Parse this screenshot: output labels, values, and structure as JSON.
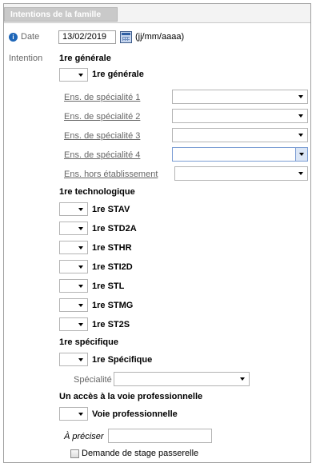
{
  "header": {
    "title": "Intentions de la famille"
  },
  "date": {
    "label": "Date",
    "value": "13/02/2019",
    "format_hint": "(jj/mm/aaaa)"
  },
  "intention_label": "Intention",
  "sections": {
    "generale": {
      "title": "1re générale",
      "option": "1re générale",
      "fields": [
        {
          "label": "Ens. de spécialité 1",
          "value": ""
        },
        {
          "label": "Ens. de spécialité 2",
          "value": ""
        },
        {
          "label": "Ens. de spécialité 3",
          "value": ""
        },
        {
          "label": "Ens. de spécialité 4",
          "value": ""
        },
        {
          "label": "Ens. hors établissement",
          "value": ""
        }
      ]
    },
    "technologique": {
      "title": "1re technologique",
      "options": [
        "1re STAV",
        "1re STD2A",
        "1re STHR",
        "1re STI2D",
        "1re STL",
        "1re STMG",
        "1re ST2S"
      ]
    },
    "specifique": {
      "title": "1re spécifique",
      "option": "1re Spécifique",
      "specialite_label": "Spécialité",
      "specialite_value": ""
    },
    "pro": {
      "title": "Un accès à la voie professionnelle",
      "option": "Voie professionnelle",
      "preciser_label": "À préciser",
      "preciser_value": "",
      "passerelle_label": "Demande de stage passerelle",
      "passerelle_checked": false
    }
  },
  "colors": {
    "info_icon": "#1e66b8",
    "header_tab": "#c9c9c9",
    "focus_border": "#7a9cd3"
  }
}
